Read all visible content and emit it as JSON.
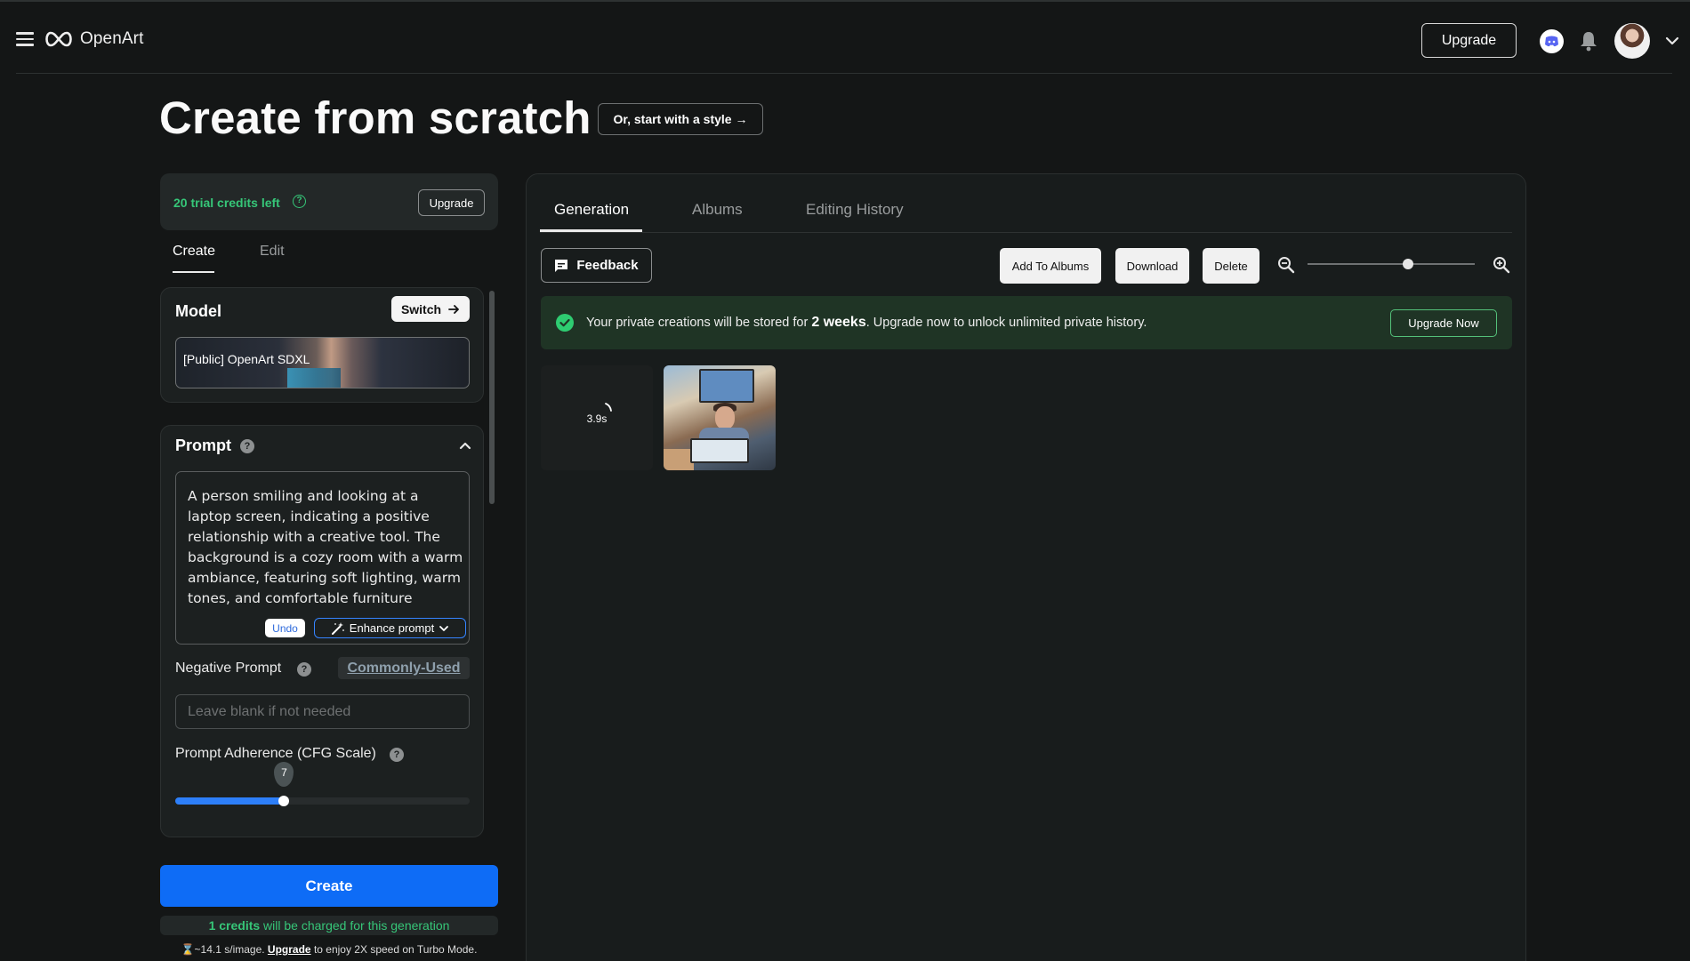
{
  "app": {
    "name": "OpenArt"
  },
  "header": {
    "upgrade_label": "Upgrade"
  },
  "page": {
    "title": "Create from scratch",
    "style_button_label": "Or, start with a style →"
  },
  "left_panel": {
    "credits_text": "20 trial credits left",
    "credits_help": "?",
    "credits_upgrade_label": "Upgrade",
    "tabs": [
      {
        "label": "Create",
        "active": true
      },
      {
        "label": "Edit",
        "active": false
      }
    ],
    "model": {
      "title": "Model",
      "switch_label": "Switch",
      "selected": "[Public] OpenArt SDXL"
    },
    "prompt": {
      "title": "Prompt",
      "help": "?",
      "text": "A person smiling and looking at a laptop screen, indicating a positive relationship with a creative tool. The background is a cozy room with a warm ambiance, featuring soft lighting, warm tones, and comfortable furniture",
      "undo_label": "Undo",
      "enhance_label": "Enhance prompt"
    },
    "negative_prompt": {
      "label": "Negative Prompt",
      "help": "?",
      "commonly_used_label": "Commonly-Used",
      "placeholder": "Leave blank if not needed",
      "value": ""
    },
    "cfg": {
      "label": "Prompt Adherence (CFG Scale)",
      "help": "?",
      "value": "7",
      "fill_fraction": 0.37
    },
    "create_label": "Create",
    "charge_bold": "1 credits",
    "charge_text": " will be charged for this generation",
    "speed_prefix": "⌛~14.1 s/image. ",
    "speed_link": "Upgrade",
    "speed_suffix": " to enjoy 2X speed on Turbo Mode."
  },
  "right_panel": {
    "tabs": [
      {
        "label": "Generation",
        "active": true
      },
      {
        "label": "Albums",
        "active": false
      },
      {
        "label": "Editing History",
        "active": false
      }
    ],
    "feedback_label": "Feedback",
    "actions": [
      "Add To Albums",
      "Download",
      "Delete"
    ],
    "zoom_fraction": 0.6,
    "notice": {
      "prefix": "Your private creations will be stored for ",
      "bold": "2 weeks",
      "suffix": ". Upgrade now to unlock unlimited private history.",
      "button_label": "Upgrade Now"
    },
    "loading_timer": "3.9s"
  },
  "colors": {
    "background": "#141616",
    "accent_blue": "#0e6cf6",
    "credit_green": "#36c678",
    "notice_bg": "#1f3425"
  },
  "icons": [
    "menu-icon",
    "openart-logo-icon",
    "discord-icon",
    "bell-icon",
    "chevron-down-icon",
    "help-icon",
    "arrow-right-icon",
    "chevron-up-icon",
    "magic-wand-icon",
    "feedback-icon",
    "zoom-out-icon",
    "zoom-in-icon",
    "check-circle-icon",
    "spinner-icon"
  ]
}
